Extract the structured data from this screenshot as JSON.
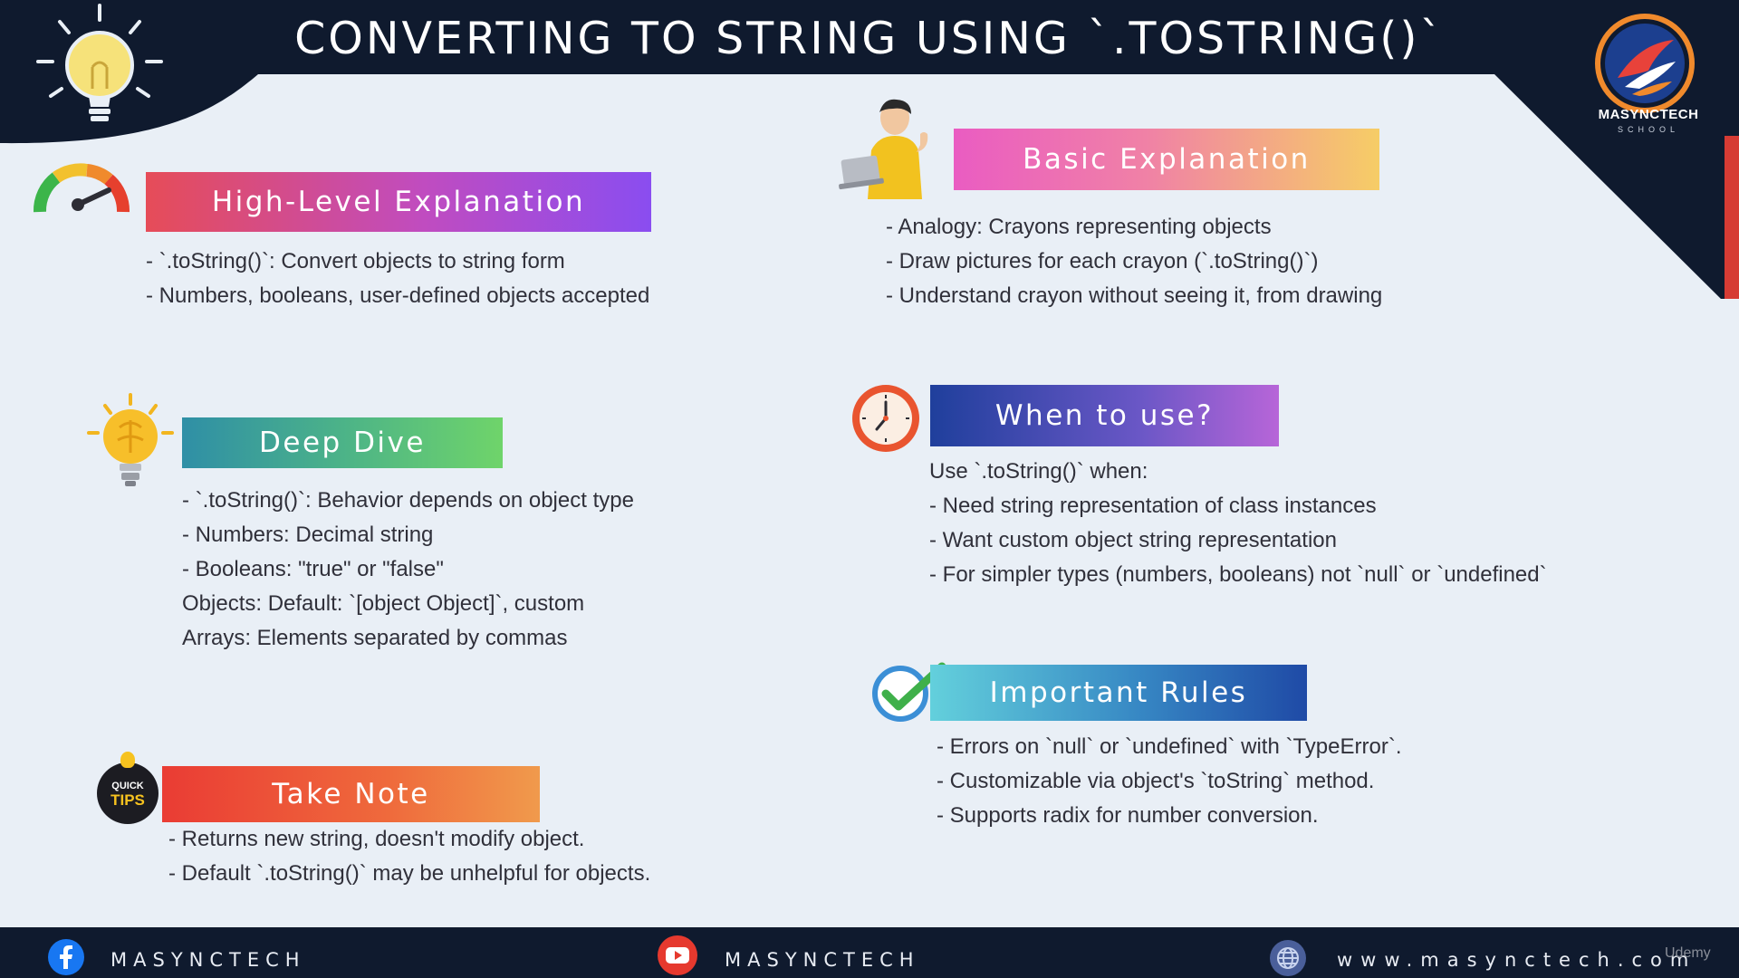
{
  "header": {
    "title": "CONVERTING TO STRING USING `.TOSTRING()`",
    "logo_name": "MASYNCTECH",
    "logo_sub": "SCHOOL"
  },
  "sections": {
    "high_level": {
      "heading": "High-Level Explanation",
      "lines": [
        "- `.toString()`: Convert objects to string form",
        "- Numbers, booleans, user-defined objects accepted"
      ]
    },
    "basic": {
      "heading": "Basic Explanation",
      "lines": [
        "- Analogy: Crayons representing objects",
        "- Draw pictures for each crayon (`.toString()`)",
        "- Understand crayon without seeing it, from drawing"
      ]
    },
    "deep_dive": {
      "heading": "Deep Dive",
      "lines": [
        "- `.toString()`: Behavior depends on object type",
        "- Numbers: Decimal string",
        "- Booleans: \"true\" or \"false\"",
        "Objects: Default: `[object Object]`, custom",
        "Arrays: Elements separated by commas"
      ]
    },
    "when_to_use": {
      "heading": "When to use?",
      "lines": [
        "Use `.toString()` when:",
        "- Need string representation of class instances",
        "- Want custom object string representation",
        "- For simpler types (numbers, booleans) not `null` or `undefined`"
      ]
    },
    "important_rules": {
      "heading": "Important Rules",
      "lines": [
        "- Errors on `null` or `undefined` with `TypeError`.",
        "- Customizable via object's `toString` method.",
        "- Supports radix for number conversion."
      ]
    },
    "take_note": {
      "heading": "Take Note",
      "badge_line1": "QUICK",
      "badge_line2": "TIPS",
      "lines": [
        "- Returns new string, doesn't modify object.",
        "- Default `.toString()` may be unhelpful for objects."
      ]
    }
  },
  "footer": {
    "facebook": "MASYNCTECH",
    "youtube": "MASYNCTECH",
    "website": "www.masynctech.com",
    "watermark": "Udemy"
  },
  "colors": {
    "navy": "#0f1a2e",
    "background": "#e9eff6",
    "accent_red": "#d63b34"
  },
  "icons": [
    "lightbulb-icon",
    "gauge-icon",
    "person-laptop-icon",
    "brain-bulb-icon",
    "clock-icon",
    "checkmark-icon",
    "quick-tips-icon",
    "facebook-icon",
    "youtube-icon",
    "globe-icon"
  ]
}
